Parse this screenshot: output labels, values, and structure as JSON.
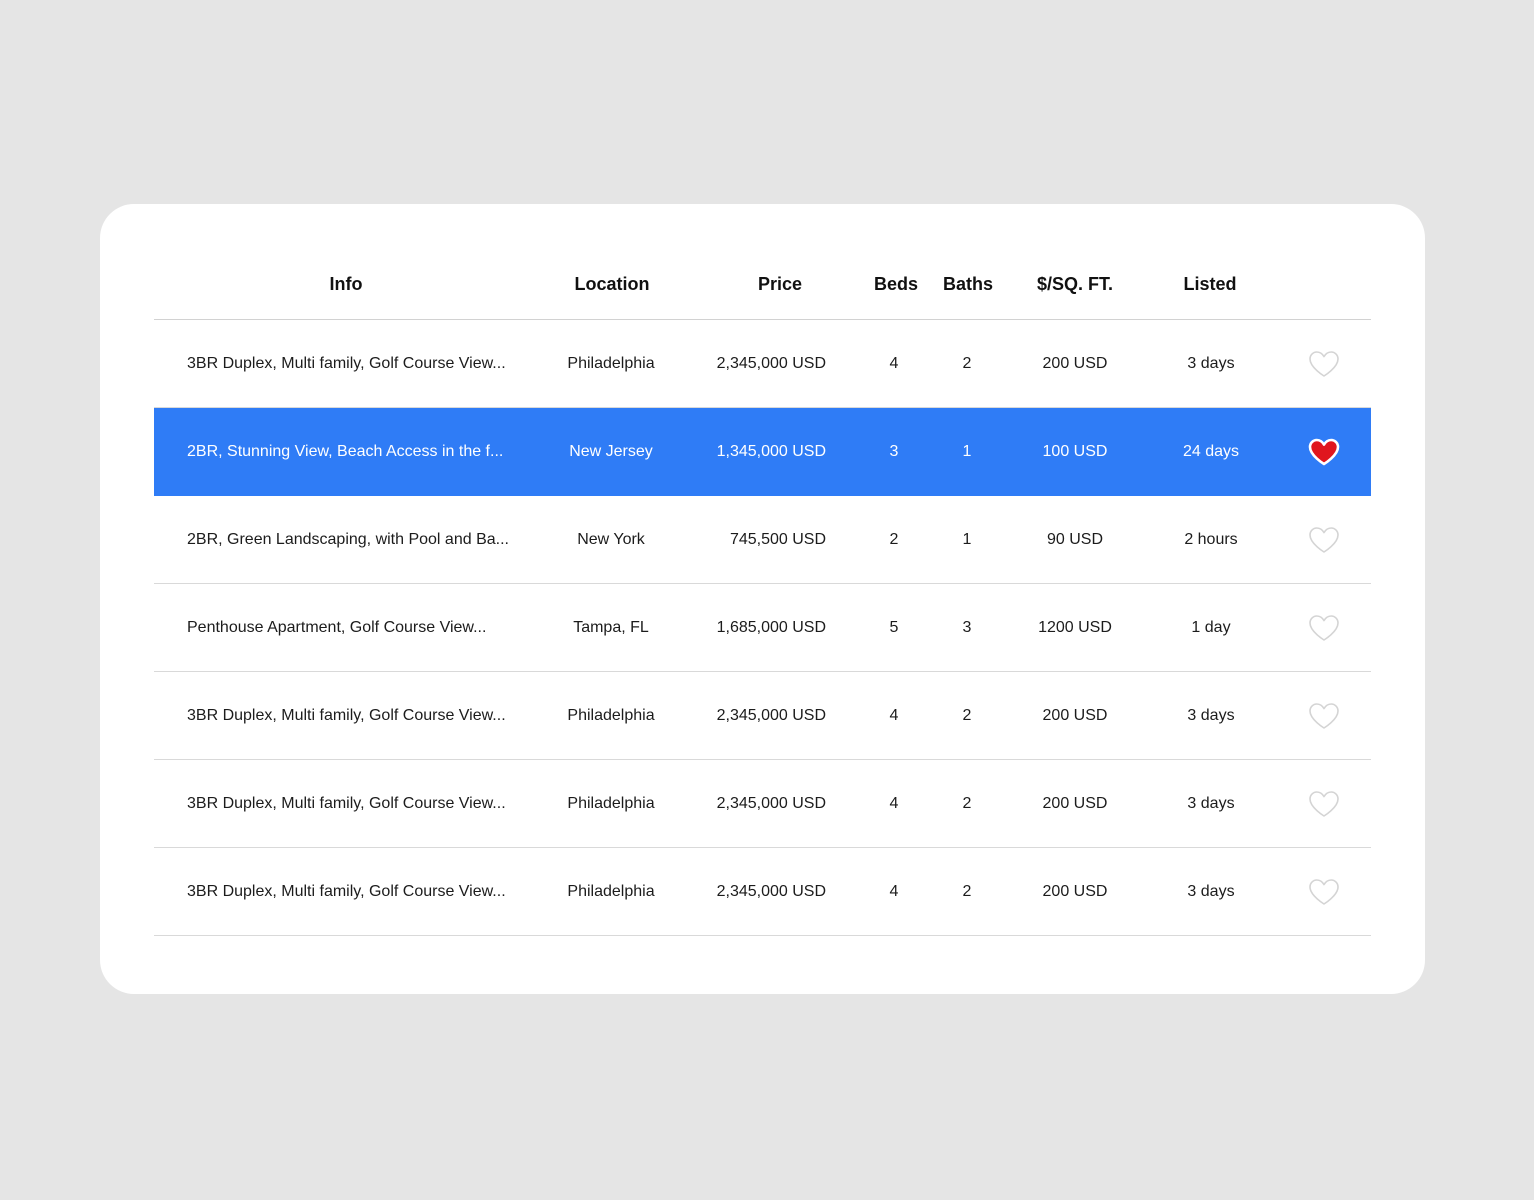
{
  "table": {
    "headers": {
      "info": "Info",
      "location": "Location",
      "price": "Price",
      "beds": "Beds",
      "baths": "Baths",
      "sqft": "$/SQ. FT.",
      "listed": "Listed"
    },
    "rows": [
      {
        "info": "3BR Duplex, Multi family, Golf Course View...",
        "location": "Philadelphia",
        "price": "2,345,000 USD",
        "beds": "4",
        "baths": "2",
        "sqft": "200 USD",
        "listed": "3 days",
        "favorite": false,
        "selected": false
      },
      {
        "info": "2BR, Stunning View, Beach Access in the f...",
        "location": "New Jersey",
        "price": "1,345,000 USD",
        "beds": "3",
        "baths": "1",
        "sqft": "100 USD",
        "listed": "24 days",
        "favorite": true,
        "selected": true
      },
      {
        "info": "2BR, Green Landscaping, with Pool and Ba...",
        "location": "New York",
        "price": "745,500 USD",
        "beds": "2",
        "baths": "1",
        "sqft": "90 USD",
        "listed": "2 hours",
        "favorite": false,
        "selected": false
      },
      {
        "info": "Penthouse Apartment, Golf Course View...",
        "location": "Tampa, FL",
        "price": "1,685,000 USD",
        "beds": "5",
        "baths": "3",
        "sqft": "1200 USD",
        "listed": "1 day",
        "favorite": false,
        "selected": false
      },
      {
        "info": "3BR Duplex, Multi family, Golf Course View...",
        "location": "Philadelphia",
        "price": "2,345,000 USD",
        "beds": "4",
        "baths": "2",
        "sqft": "200 USD",
        "listed": "3 days",
        "favorite": false,
        "selected": false
      },
      {
        "info": "3BR Duplex, Multi family, Golf Course View...",
        "location": "Philadelphia",
        "price": "2,345,000 USD",
        "beds": "4",
        "baths": "2",
        "sqft": "200 USD",
        "listed": "3 days",
        "favorite": false,
        "selected": false
      },
      {
        "info": "3BR Duplex, Multi family, Golf Course View...",
        "location": "Philadelphia",
        "price": "2,345,000 USD",
        "beds": "4",
        "baths": "2",
        "sqft": "200 USD",
        "listed": "3 days",
        "favorite": false,
        "selected": false
      }
    ]
  },
  "icons": {
    "favorite": "heart-icon"
  },
  "colors": {
    "background": "#e5e5e5",
    "card": "#ffffff",
    "selected_row": "#2f7cf6",
    "favorite_fill": "#e0161e",
    "heart_outline": "#d4d4d4"
  }
}
